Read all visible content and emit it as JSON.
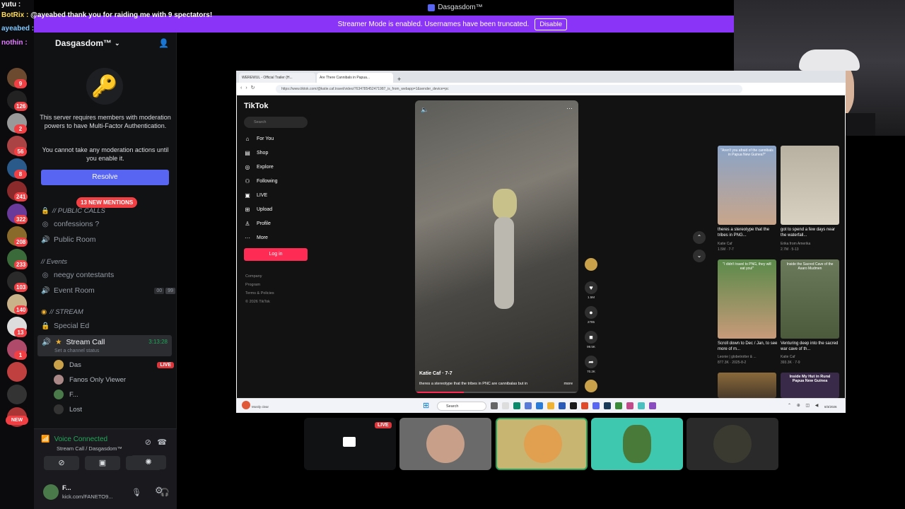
{
  "window": {
    "title": "Dasgasdom™"
  },
  "banner": {
    "text": "Streamer Mode is enabled. Usernames have been truncated.",
    "disable_label": "Disable"
  },
  "chat": [
    {
      "user": "yutu :",
      "message": "",
      "color": "#ffffff"
    },
    {
      "user": "BotRix :",
      "message": "@ayeabed thank you for raiding me with 9 spectators!",
      "color": "#ffdd55"
    },
    {
      "user": "ayeabed :",
      "message": "",
      "color": "#7fc8ff"
    },
    {
      "user": "nothin :",
      "message": "",
      "color": "#e07bff"
    }
  ],
  "rail": {
    "badges": [
      "9",
      "126",
      "2",
      "56",
      "8",
      "241",
      "322",
      "208",
      "233",
      "103",
      "140",
      "13",
      "1"
    ],
    "new_label": "NEW"
  },
  "sidebar": {
    "server_name": "Dasgasdom™",
    "mfa_text_1": "This server requires members with moderation powers to have Multi-Factor Authentication.",
    "mfa_text_2": "You cannot take any moderation actions until you enable it.",
    "resolve_label": "Resolve",
    "mentions_label": "13 NEW MENTIONS",
    "categories": {
      "public": "// PUBLIC CALLS",
      "events": "// Events",
      "stream": "// STREAM"
    },
    "channels": {
      "confessions": "confessions ?",
      "public_room": "Public Room",
      "neegy": "neegy contestants",
      "event_room": "Event Room",
      "event_room_count_a": "00",
      "event_room_count_b": "99",
      "special_ed": "Special Ed",
      "stream_call": "Stream Call",
      "stream_call_timer": "3:13:28",
      "stream_call_status": "Set a channel status"
    },
    "members": [
      {
        "name": "Das",
        "live": true
      },
      {
        "name": "Fanos Only Viewer",
        "live": false
      },
      {
        "name": "F...",
        "live": false
      },
      {
        "name": "Lost",
        "live": false
      }
    ],
    "live_label": "LIVE"
  },
  "voice": {
    "status": "Voice Connected",
    "location": "Stream Call / Dasgasdom™"
  },
  "user": {
    "name": "F...",
    "status": "kick.com/FANETO9..."
  },
  "browser": {
    "tabs": [
      "WEREWUL - Official Trailer (H...",
      "Are There Cannibals in Papua..."
    ],
    "url": "https://www.tiktok.com/@katie.caf.travel/video/7634785452471987_is_from_webapp=1&sender_device=pc"
  },
  "tiktok": {
    "logo": "TikTok",
    "search_placeholder": "Search",
    "nav": [
      "For You",
      "Shop",
      "Explore",
      "Following",
      "LIVE",
      "Upload",
      "Profile",
      "More"
    ],
    "login_label": "Log in",
    "footer": [
      "Company",
      "Program",
      "Terms & Policies",
      "© 2026 TikTok"
    ],
    "video": {
      "author": "Katie Caf · 7-7",
      "caption": "theres a stereotype that the tribes in PNC are cannibalas but in",
      "more": "more"
    },
    "actions": {
      "likes": "1.5M",
      "comments": "2785",
      "saves": "99.5K",
      "shares": "70.2K"
    },
    "recs": [
      {
        "overlay": "\"Aren't you afraid of the cannibals in Papua New Guinea?\"",
        "caption": "theres a stereotype that the tribes in PNG...",
        "meta1": "Katie Caf",
        "meta2": "1.5M · 7-7"
      },
      {
        "overlay": "",
        "caption": "got to spend a few days near the waterfall...",
        "meta1": "Erika from Amerika",
        "meta2": "2.7M · 5-13"
      },
      {
        "overlay": "\"I didn't travel to PNG, they will eat you!\"",
        "caption": "Scroll down to Dec / Jan, to see more of m...",
        "meta1": "Leonie | globetrotter & ...",
        "meta2": "877.3K · 2025-8-2"
      },
      {
        "overlay": "Inside the Sacred Cave of the Asaro Mudmen",
        "caption": "Venturing deep into the sacred war cave of th...",
        "meta1": "Katie Caf",
        "meta2": "393.3K · 7-9"
      },
      {
        "overlay": "",
        "caption": "",
        "meta1": "",
        "meta2": ""
      },
      {
        "overlay": "Inside My Hut in Rural Papua New Guinea",
        "caption": "",
        "meta1": "",
        "meta2": ""
      }
    ]
  },
  "taskbar": {
    "weather": "Mostly clear",
    "search": "Search",
    "date": "8/3/2026"
  },
  "tiles": {
    "live_label": "LIVE"
  },
  "colors": {
    "accent": "#5865f2",
    "banner": "#8a34f7",
    "live": "#da373c",
    "tiktok": "#fe2c55",
    "voice": "#23a55a"
  }
}
